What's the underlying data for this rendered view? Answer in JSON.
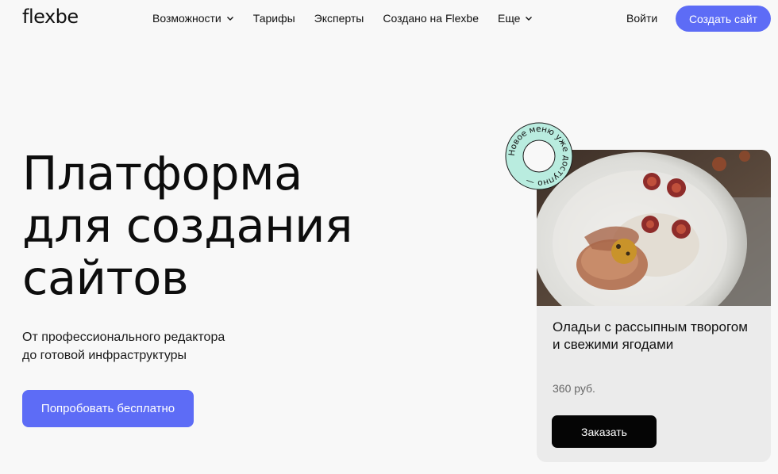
{
  "header": {
    "logo": "flexbe",
    "nav": [
      {
        "label": "Возможности",
        "dropdown": true
      },
      {
        "label": "Тарифы",
        "dropdown": false
      },
      {
        "label": "Эксперты",
        "dropdown": false
      },
      {
        "label": "Создано на Flexbe",
        "dropdown": false
      },
      {
        "label": "Еще",
        "dropdown": true
      }
    ],
    "login": "Войти",
    "create_button": "Создать сайт"
  },
  "hero": {
    "title_lines": [
      "Платформа",
      "для создания",
      "сайтов"
    ],
    "subtitle_lines": [
      "От профессионального редактора",
      "до готовой инфраструктуры"
    ],
    "try_button": "Попробовать бесплатно"
  },
  "badge": {
    "text": "Новое меню уже доступно —"
  },
  "card": {
    "title": "Оладьи с рассыпным творогом и свежими ягодами",
    "price": "360 руб.",
    "order_button": "Заказать"
  },
  "colors": {
    "accent": "#5d6cf6",
    "badge_ring": "#b9ecdf",
    "background": "#f8f8f8",
    "card_bg": "#ebebeb"
  }
}
